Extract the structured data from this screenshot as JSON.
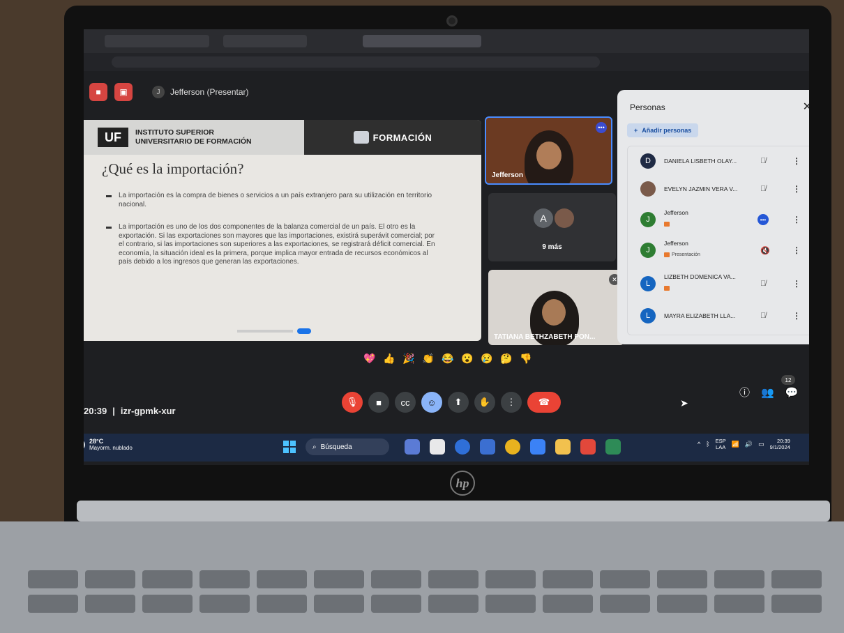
{
  "header": {
    "presenter_label": "Jefferson (Presentar)",
    "presenter_initial": "J"
  },
  "slide": {
    "institution_line1": "INSTITUTO SUPERIOR",
    "institution_line2": "UNIVERSITARIO DE FORMACIÓN",
    "logo_text": "UF",
    "brand": "FORMACIÓN",
    "title": "¿Qué es la importación?",
    "bullet1": "La importación es la compra de bienes o servicios a un país extranjero para su utilización en territorio nacional.",
    "bullet2": "La importación es uno de los dos componentes de la balanza comercial de un país. El otro es la exportación. Si las exportaciones son mayores que las importaciones, existirá superávit comercial; por el contrario, si las importaciones son superiores a las exportaciones, se registrará déficit comercial. En economía, la situación ideal es la primera, porque implica mayor entrada de recursos económicos al país debido a los ingresos que generan las exportaciones."
  },
  "tiles": {
    "jefferson": "Jefferson",
    "more_initial": "A",
    "more_label": "9 más",
    "tatiana": "TATIANA BETHZABETH PON..."
  },
  "people_panel": {
    "title": "Personas",
    "add_label": "Añadir personas",
    "participants": [
      {
        "name": "DANIELA LISBETH OLAY...",
        "initial": "D",
        "color": "#1f2a44"
      },
      {
        "name": "EVELYN JAZMIN VERA V...",
        "initial": "",
        "color": "#7a5a4a"
      },
      {
        "name": "Jefferson",
        "initial": "J",
        "color": "#2e7d32"
      },
      {
        "name": "Jefferson",
        "initial": "J",
        "color": "#2e7d32",
        "tag": "Presentación"
      },
      {
        "name": "LIZBETH DOMENICA VA...",
        "initial": "L",
        "color": "#1565c0"
      },
      {
        "name": "MAYRA ELIZABETH LLA...",
        "initial": "L",
        "color": "#1565c0"
      }
    ]
  },
  "meeting": {
    "time": "20:39",
    "code": "izr-gpmk-xur",
    "people_count": "12"
  },
  "taskbar": {
    "temp": "28°C",
    "weather": "Mayorm. nublado",
    "search": "Búsqueda",
    "lang1": "ESP",
    "lang2": "LAA",
    "clock_time": "20:39",
    "clock_date": "9/1/2024"
  },
  "colors": {
    "end_call": "#ea4335",
    "accent": "#8ab4f8",
    "taskbar": "#1c2a44"
  }
}
